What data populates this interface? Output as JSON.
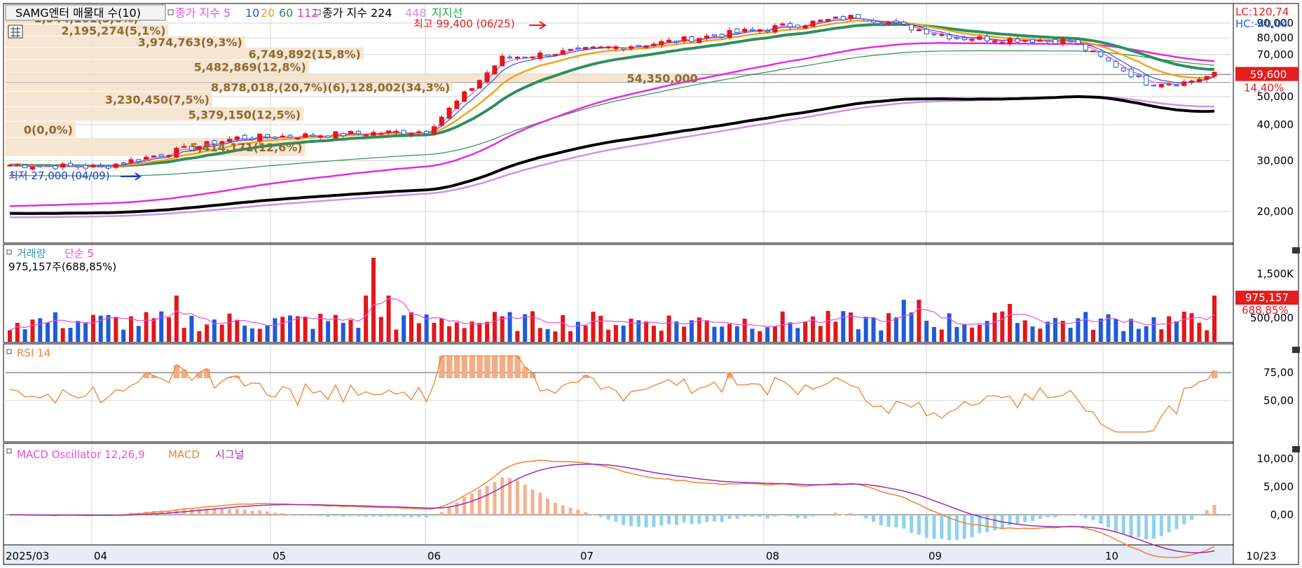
{
  "colors": {
    "up": "#e3161b",
    "down": "#1f5bd6",
    "ma5": "#e94ee0",
    "ma10": "#2f55d6",
    "ma20": "#f2a41d",
    "ma60": "#2f8f5a",
    "ma112": "#e22de0",
    "ma224": "#000000",
    "ma448": "#c995ee",
    "ma448_label": "#c995ee",
    "sr_line": "#25a84a",
    "band": "#f6e4cf",
    "band_text": "#8d6a35",
    "rsi": "#f08230",
    "rsi_fill": "#f2ad86",
    "macd": "#f08230",
    "signal": "#9d2ca8",
    "osc_pos": "#f5b08f",
    "osc_neg": "#8ed2ef",
    "grid": "#d4d4d4",
    "price_tag_bg": "#e51d1d",
    "lc": "#e51d1d",
    "hc": "#1f5bd6",
    "high_label": "#e51d1d",
    "low_label": "#1f3bbd",
    "volume_ma": "#e94ee0"
  },
  "header": {
    "title_box": "SAMG엔터 매물대 수(10)",
    "legend": [
      {
        "text": "종가 지수 5",
        "color": "#e94ee0"
      },
      {
        "text": "10",
        "color": "#2f55d6"
      },
      {
        "text": "20",
        "color": "#f2a41d"
      },
      {
        "text": "60",
        "color": "#2f8f5a"
      },
      {
        "text": "112",
        "color": "#e22de0"
      },
      {
        "text": "종가 지수 224",
        "color": "#000000"
      },
      {
        "text": "448",
        "color": "#c995ee"
      },
      {
        "text": "지지선",
        "color": "#25a84a"
      }
    ],
    "lc": "LC:120,74",
    "hc": "HC:-40,04"
  },
  "price_axis": {
    "ticks": [
      "90,000",
      "80,000",
      "70,000",
      "60,000",
      "50,000",
      "40,000",
      "30,000",
      "20,000"
    ],
    "current_price": "59,600",
    "current_change": "14,40%"
  },
  "annotations": {
    "high": "최고 99,400 (06/25)",
    "low": "최저 27,000 (04/09)"
  },
  "volume_profile": [
    {
      "label": "1,544,161(3,6%)"
    },
    {
      "label": "2,195,274(5,1%)"
    },
    {
      "label": "3,974,763(9,3%)"
    },
    {
      "label": "6,749,892(15,8%)"
    },
    {
      "label": "5,482,869(12,8%)"
    },
    {
      "label": "8,878,018,(20,7%)(6),128,002(34,3%)"
    },
    {
      "label": "54,350,000"
    },
    {
      "label": "3,230,450(7,5%)"
    },
    {
      "label": "0(0,0%)"
    },
    {
      "label": "5,379,150(12,5%)"
    },
    {
      "label": "5,414,171(12,6%)"
    }
  ],
  "volume_panel": {
    "title": "거래량",
    "ma_label": "단순 5",
    "summary": "975,157주(688,85%)",
    "ticks": [
      "1,500K",
      "500,000"
    ],
    "last_value": "975,157",
    "last_pct": "688,85%"
  },
  "rsi_panel": {
    "title": "RSI 14",
    "ticks": [
      "75,00",
      "50,00"
    ]
  },
  "macd_panel": {
    "title_osc": "MACD Oscillator 12,26,9",
    "title_macd": "MACD",
    "title_signal": "시그널",
    "ticks": [
      "10,000",
      "5,000",
      "0,00"
    ]
  },
  "x_axis": {
    "labels": [
      "2025/03",
      "04",
      "05",
      "06",
      "07",
      "08",
      "09",
      "10"
    ],
    "end_label": "10/23"
  },
  "chart_data": {
    "type": "candlestick",
    "title": "SAMG엔터",
    "indicators": [
      "종가 지수 5",
      "10",
      "20",
      "60",
      "112",
      "종가 지수 224",
      "448",
      "지지선",
      "거래량",
      "단순 5",
      "RSI 14",
      "MACD Oscillator 12,26,9",
      "MACD",
      "시그널"
    ],
    "price_scale": "log",
    "ylim": [
      16000,
      100000
    ],
    "months": [
      "2025/03",
      "04",
      "05",
      "06",
      "07",
      "08",
      "09",
      "10",
      "10/23"
    ],
    "current_close": 59600,
    "change_pct": 14.4,
    "period_high": {
      "value": 99400,
      "date": "06/25"
    },
    "period_low": {
      "value": 27000,
      "date": "04/09"
    },
    "price_anchors": [
      {
        "month": "2025/03",
        "close": 29000
      },
      {
        "month": "04",
        "close": 29000
      },
      {
        "month": "04",
        "close": 36000
      },
      {
        "month": "05",
        "close": 38000
      },
      {
        "month": "05",
        "close": 68000
      },
      {
        "month": "06",
        "close": 78000
      },
      {
        "month": "06",
        "close": 95000
      },
      {
        "month": "07",
        "close": 80000
      },
      {
        "month": "08",
        "close": 78000
      },
      {
        "month": "08",
        "close": 56000
      },
      {
        "month": "09",
        "close": 56000
      },
      {
        "month": "10",
        "close": 58000
      },
      {
        "month": "10/23",
        "close": 59600
      }
    ],
    "volume_profile_pct": [
      3.6,
      5.1,
      9.3,
      15.8,
      12.8,
      20.7,
      34.3,
      7.5,
      0.0,
      12.5,
      12.6
    ],
    "volume_last": 975157,
    "volume_last_pct": 688.85,
    "rsi_ref_lines": [
      75,
      50
    ],
    "macd_ref_line": 0
  }
}
